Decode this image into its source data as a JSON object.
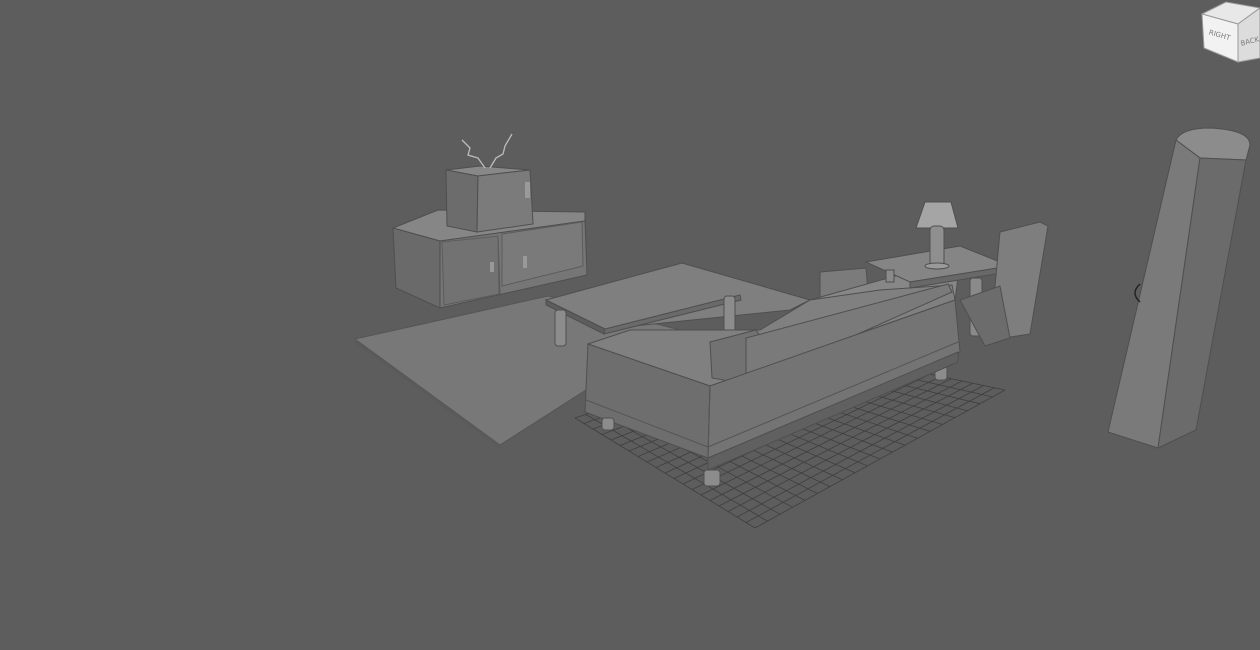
{
  "viewport": {
    "background": "#5d5d5d",
    "view": "perspective"
  },
  "viewcube": {
    "faces": {
      "right": "RIGHT",
      "back": "BACK"
    }
  },
  "scene": {
    "objects": [
      "rug",
      "tv-cabinet",
      "tv",
      "tv-antenna",
      "coffee-table",
      "sectional-sofa",
      "side-table",
      "table-lamp",
      "armchair",
      "tall-cabinet",
      "ground-grid"
    ]
  },
  "colors": {
    "top_face": "#878787",
    "light_face": "#7e7e7e",
    "mid_face": "#6f6f6f",
    "dark_face": "#626262",
    "outline": "#4f4f4f",
    "grid": "#3f3f3f"
  }
}
